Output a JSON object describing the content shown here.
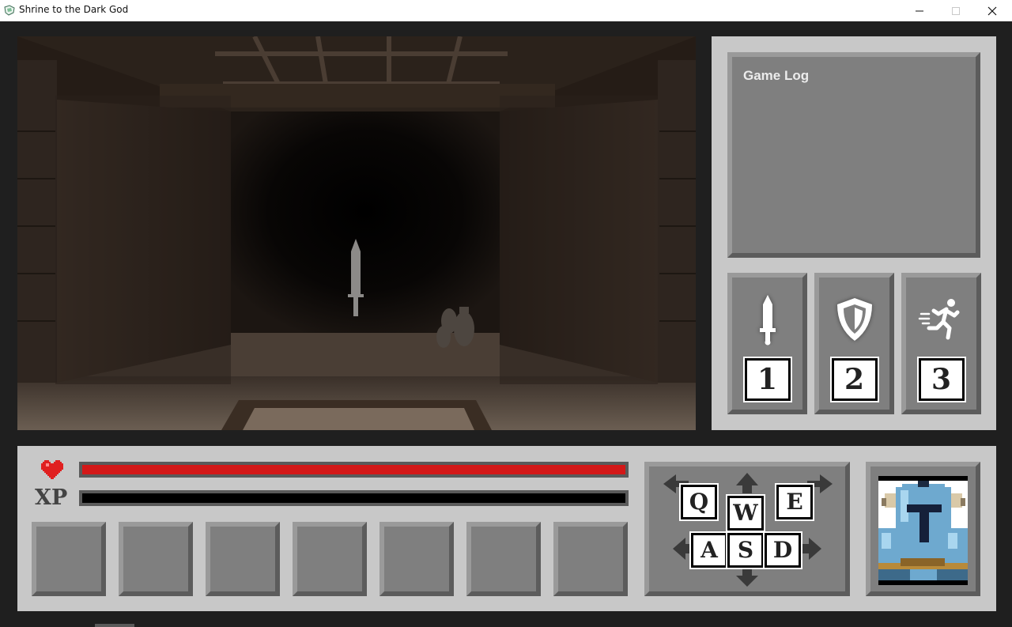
{
  "window": {
    "title": "Shrine to the Dark God",
    "icons": [
      "app-icon",
      "minimize-icon",
      "maximize-icon",
      "close-icon"
    ]
  },
  "game_log": {
    "title": "Game Log",
    "entries": []
  },
  "actions": [
    {
      "name": "attack",
      "icon": "sword-icon",
      "key": "1"
    },
    {
      "name": "defend",
      "icon": "shield-icon",
      "key": "2"
    },
    {
      "name": "flee",
      "icon": "running-figure-icon",
      "key": "3"
    }
  ],
  "stats": {
    "hp_icon": "heart-icon",
    "hp_fraction": 1.0,
    "hp_color": "#d31818",
    "xp_label": "XP",
    "xp_fraction": 0.0,
    "xp_color": "#000000"
  },
  "inventory": {
    "slot_count": 7,
    "slots": [
      "",
      "",
      "",
      "",
      "",
      "",
      ""
    ]
  },
  "movement": {
    "keys": [
      "Q",
      "W",
      "E",
      "A",
      "S",
      "D"
    ],
    "arrow_icons": [
      "turn-left-arrow-icon",
      "forward-arrow-icon",
      "turn-right-arrow-icon",
      "left-arrow-icon",
      "back-arrow-icon",
      "right-arrow-icon"
    ]
  },
  "portrait": {
    "icon": "knight-portrait-icon"
  },
  "colors": {
    "panel": "#c8c8c8",
    "button": "#7f7f7f",
    "background": "#1f1f1f"
  }
}
